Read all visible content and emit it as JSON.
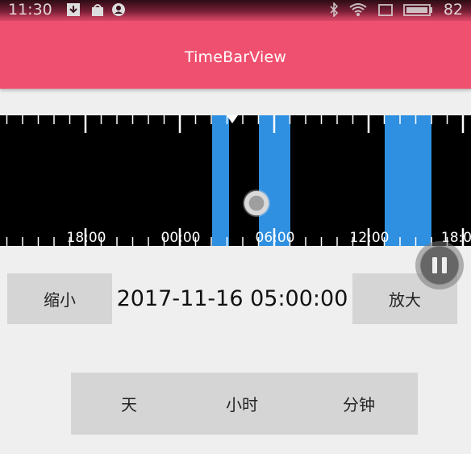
{
  "status_bar": {
    "time": "11:30",
    "battery": "82",
    "icons": [
      "download-icon",
      "shop-icon",
      "account-icon",
      "bluetooth-icon",
      "wifi-icon",
      "no-sim-icon",
      "battery-icon"
    ]
  },
  "app_bar": {
    "title": "TimeBarView"
  },
  "timebar": {
    "tick_labels": [
      "00",
      "18:00",
      "00:00",
      "06:00",
      "12:00",
      "18:0"
    ],
    "colors": {
      "background": "#000000",
      "segment": "#2f8fe0",
      "tick": "#ffffff"
    }
  },
  "controls": {
    "zoom_out_label": "缩小",
    "zoom_in_label": "放大",
    "current_time": "2017-11-16 05:00:00"
  },
  "mode_selector": {
    "day": "天",
    "hour": "小时",
    "minute": "分钟"
  },
  "accent": "#f0506f"
}
